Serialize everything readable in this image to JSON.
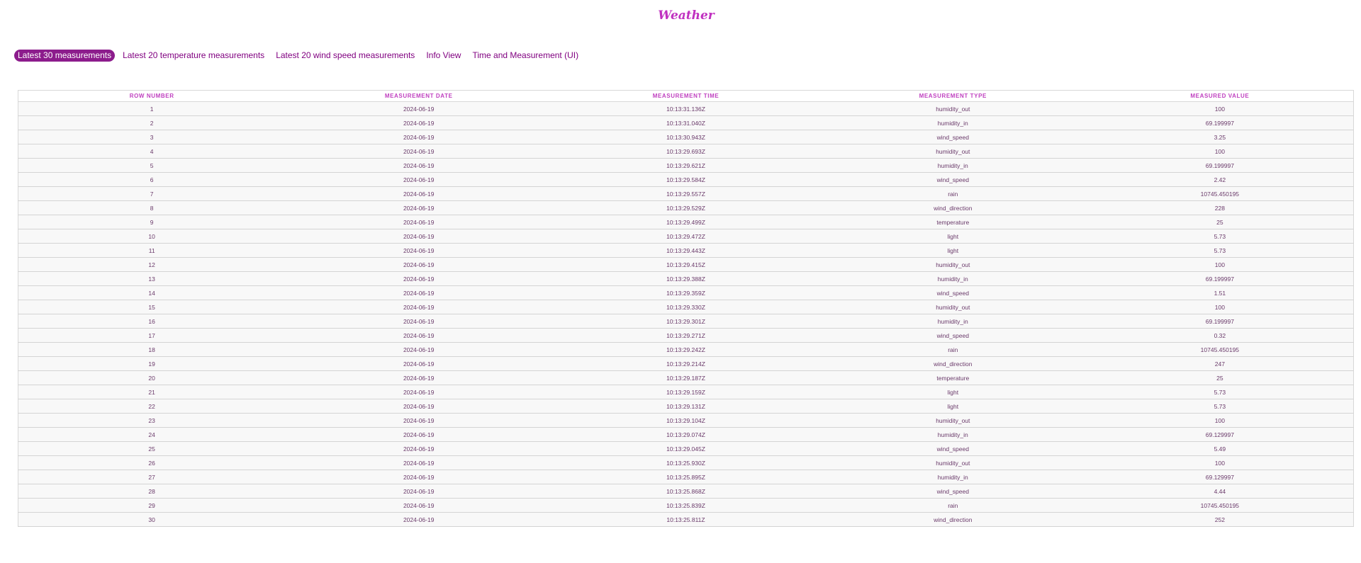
{
  "app": {
    "title": "Weather"
  },
  "nav": {
    "items": [
      {
        "label": "Latest 30 measurements",
        "active": true
      },
      {
        "label": "Latest 20 temperature measurements",
        "active": false
      },
      {
        "label": "Latest 20 wind speed measurements",
        "active": false
      },
      {
        "label": "Info View",
        "active": false
      },
      {
        "label": "Time and Measurement (UI)",
        "active": false
      }
    ]
  },
  "table": {
    "headers": [
      "Row number",
      "Measurement date",
      "Measurement time",
      "Measurement type",
      "Measured value"
    ],
    "rows": [
      [
        "1",
        "2024-06-19",
        "10:13:31.136Z",
        "humidity_out",
        "100"
      ],
      [
        "2",
        "2024-06-19",
        "10:13:31.040Z",
        "humidity_in",
        "69.199997"
      ],
      [
        "3",
        "2024-06-19",
        "10:13:30.943Z",
        "wind_speed",
        "3.25"
      ],
      [
        "4",
        "2024-06-19",
        "10:13:29.693Z",
        "humidity_out",
        "100"
      ],
      [
        "5",
        "2024-06-19",
        "10:13:29.621Z",
        "humidity_in",
        "69.199997"
      ],
      [
        "6",
        "2024-06-19",
        "10:13:29.584Z",
        "wind_speed",
        "2.42"
      ],
      [
        "7",
        "2024-06-19",
        "10:13:29.557Z",
        "rain",
        "10745.450195"
      ],
      [
        "8",
        "2024-06-19",
        "10:13:29.529Z",
        "wind_direction",
        "228"
      ],
      [
        "9",
        "2024-06-19",
        "10:13:29.499Z",
        "temperature",
        "25"
      ],
      [
        "10",
        "2024-06-19",
        "10:13:29.472Z",
        "light",
        "5.73"
      ],
      [
        "11",
        "2024-06-19",
        "10:13:29.443Z",
        "light",
        "5.73"
      ],
      [
        "12",
        "2024-06-19",
        "10:13:29.415Z",
        "humidity_out",
        "100"
      ],
      [
        "13",
        "2024-06-19",
        "10:13:29.388Z",
        "humidity_in",
        "69.199997"
      ],
      [
        "14",
        "2024-06-19",
        "10:13:29.359Z",
        "wind_speed",
        "1.51"
      ],
      [
        "15",
        "2024-06-19",
        "10:13:29.330Z",
        "humidity_out",
        "100"
      ],
      [
        "16",
        "2024-06-19",
        "10:13:29.301Z",
        "humidity_in",
        "69.199997"
      ],
      [
        "17",
        "2024-06-19",
        "10:13:29.271Z",
        "wind_speed",
        "0.32"
      ],
      [
        "18",
        "2024-06-19",
        "10:13:29.242Z",
        "rain",
        "10745.450195"
      ],
      [
        "19",
        "2024-06-19",
        "10:13:29.214Z",
        "wind_direction",
        "247"
      ],
      [
        "20",
        "2024-06-19",
        "10:13:29.187Z",
        "temperature",
        "25"
      ],
      [
        "21",
        "2024-06-19",
        "10:13:29.159Z",
        "light",
        "5.73"
      ],
      [
        "22",
        "2024-06-19",
        "10:13:29.131Z",
        "light",
        "5.73"
      ],
      [
        "23",
        "2024-06-19",
        "10:13:29.104Z",
        "humidity_out",
        "100"
      ],
      [
        "24",
        "2024-06-19",
        "10:13:29.074Z",
        "humidity_in",
        "69.129997"
      ],
      [
        "25",
        "2024-06-19",
        "10:13:29.045Z",
        "wind_speed",
        "5.49"
      ],
      [
        "26",
        "2024-06-19",
        "10:13:25.930Z",
        "humidity_out",
        "100"
      ],
      [
        "27",
        "2024-06-19",
        "10:13:25.895Z",
        "humidity_in",
        "69.129997"
      ],
      [
        "28",
        "2024-06-19",
        "10:13:25.868Z",
        "wind_speed",
        "4.44"
      ],
      [
        "29",
        "2024-06-19",
        "10:13:25.839Z",
        "rain",
        "10745.450195"
      ],
      [
        "30",
        "2024-06-19",
        "10:13:25.811Z",
        "wind_direction",
        "252"
      ]
    ]
  },
  "colors": {
    "accent": "#c030c0",
    "nav_active_bg": "#8c1c8c",
    "nav_text": "#800080",
    "cell_text": "#6a3a6a"
  }
}
